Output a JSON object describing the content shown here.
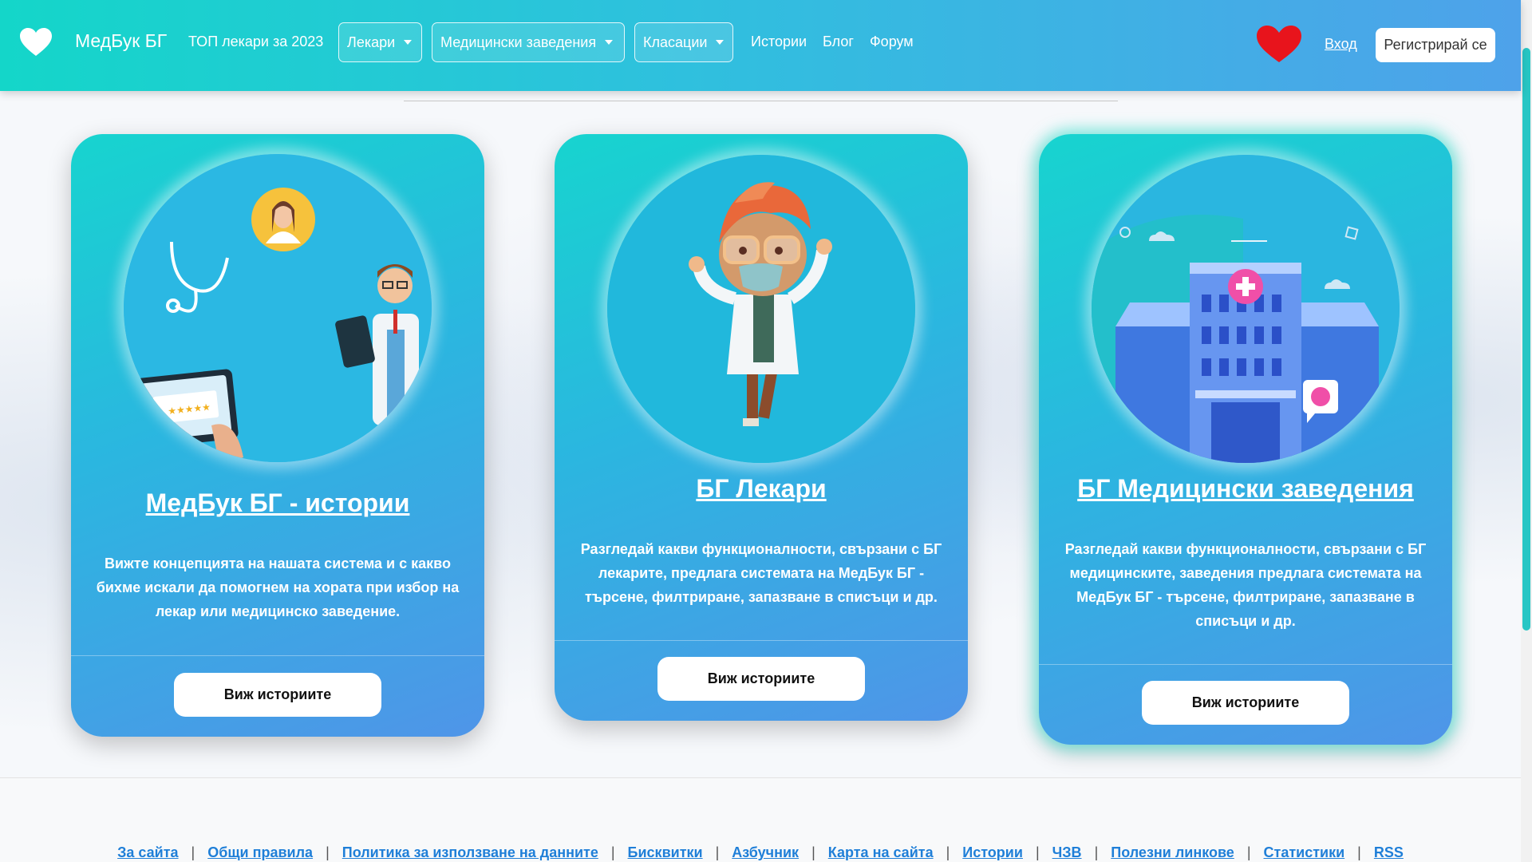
{
  "navbar": {
    "brand": "МедБук БГ",
    "top_doctors": "ТОП лекари за 2023",
    "dropdowns": [
      "Лекари",
      "Медицински заведения",
      "Класации"
    ],
    "links": [
      "Истории",
      "Блог",
      "Форум"
    ],
    "login": "Вход",
    "register": "Регистрирай се"
  },
  "cards": [
    {
      "title": "МедБук БГ - истории",
      "description": "Вижте концепцията на нашата система и с какво бихме искали да помогнем на хората при избор на лекар или медицинско заведение.",
      "button": "Виж историите"
    },
    {
      "title": "БГ Лекари",
      "description": "Разгледай какви функционалности, свързани с БГ лекарите, предлага системата на МедБук БГ - търсене, филтриране, запазване в списъци и др.",
      "button": "Виж историите"
    },
    {
      "title": "БГ Медицински заведения",
      "description": "Разгледай какви функционалности, свързани с БГ медицинските, заведения предлага системата на МедБук БГ - търсене, филтриране, запазване в списъци и др.",
      "button": "Виж историите"
    }
  ],
  "footer": {
    "links": [
      "За сайта",
      "Общи правила",
      "Политика за използване на данните",
      "Бисквитки",
      "Азбучник",
      "Карта на сайта",
      "Истории",
      "ЧЗВ",
      "Полезни линкове",
      "Статистики",
      "RSS"
    ]
  },
  "colors": {
    "nav_gradient_start": "#14d6c9",
    "nav_gradient_end": "#4ea2ea",
    "heart_red": "#e8141c",
    "link_blue": "#1f7fd8"
  }
}
